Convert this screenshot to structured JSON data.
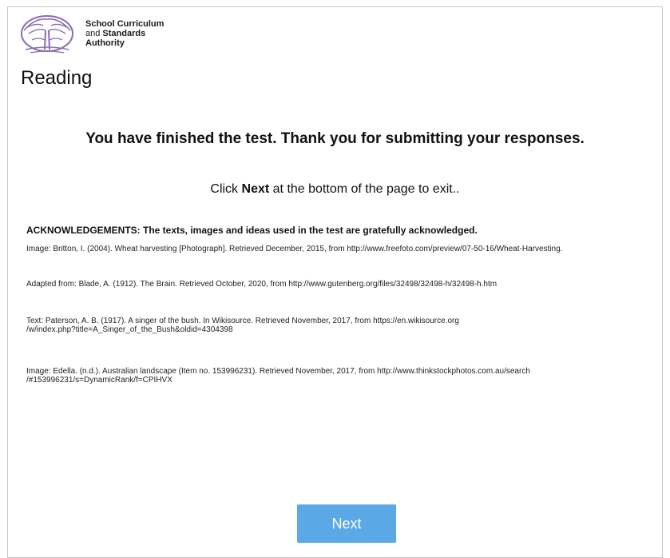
{
  "header": {
    "org_name_line1": "School Curriculum",
    "org_name_line2_prefix": "and",
    "org_name_line2_bold": "Standards",
    "org_name_line3": "Authority",
    "logo_icon": "tree-logo-icon",
    "page_title": "Reading"
  },
  "main": {
    "finished_message": "You have finished the test. Thank you for submitting your responses.",
    "click_prefix": "Click",
    "click_bold": "Next",
    "click_suffix": "at the bottom of the page to exit..",
    "acknowledgements_heading": "ACKNOWLEDGEMENTS: The texts, images and ideas used in the test are gratefully acknowledged.",
    "acknowledgements": [
      {
        "line1": "Image: Britton, I. (2004). Wheat harvesting [Photograph]. Retrieved December, 2015, from http://www.freefoto.com/preview/07-50-16/Wheat-Harvesting.",
        "line2": ""
      },
      {
        "line1": "Adapted from: Blade, A. (1912). The Brain. Retrieved October, 2020, from http://www.gutenberg.org/files/32498/32498-h/32498-h.htm",
        "line2": ""
      },
      {
        "line1": "Text: Paterson, A. B. (1917). A singer of the bush. In Wikisource. Retrieved November, 2017, from https://en.wikisource.org",
        "line2": "/w/index.php?title=A_Singer_of_the_Bush&oldid=4304398"
      },
      {
        "line1": "Image: Edella. (n.d.). Australian landscape (Item no. 153996231). Retrieved November, 2017, from http://www.thinkstockphotos.com.au/search",
        "line2": "/#153996231/s=DynamicRank/f=CPIHVX"
      }
    ]
  },
  "footer": {
    "next_label": "Next"
  },
  "colors": {
    "accent_button": "#5aa9e6",
    "logo_purple": "#8a6bb1"
  }
}
